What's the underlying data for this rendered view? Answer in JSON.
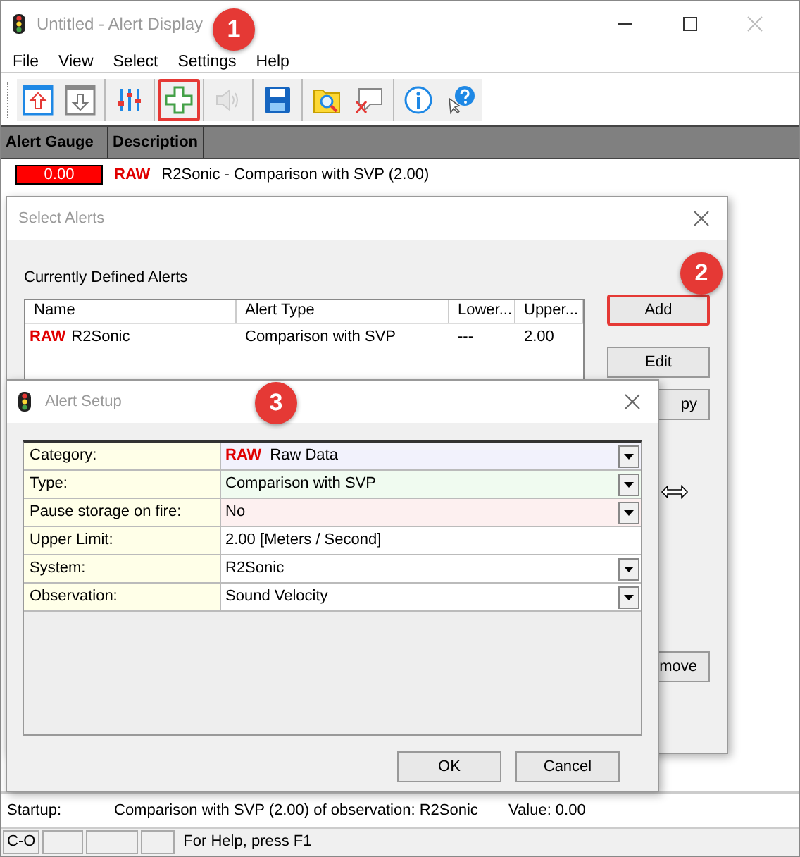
{
  "window": {
    "title": "Untitled - Alert Display"
  },
  "menu": [
    "File",
    "View",
    "Select",
    "Settings",
    "Help"
  ],
  "toolbar": [
    [
      {
        "kind": "upload",
        "highlighted": false,
        "disabled": false
      },
      {
        "kind": "download",
        "highlighted": false,
        "disabled": false
      }
    ],
    [
      {
        "kind": "sliders",
        "highlighted": false,
        "disabled": false
      }
    ],
    [
      {
        "kind": "add",
        "highlighted": true,
        "disabled": false
      }
    ],
    [
      {
        "kind": "sound",
        "highlighted": false,
        "disabled": true
      }
    ],
    [
      {
        "kind": "save",
        "highlighted": false,
        "disabled": false
      }
    ],
    [
      {
        "kind": "find",
        "highlighted": false,
        "disabled": false
      },
      {
        "kind": "clear",
        "highlighted": false,
        "disabled": false
      }
    ],
    [
      {
        "kind": "info",
        "highlighted": false,
        "disabled": false
      },
      {
        "kind": "help",
        "highlighted": false,
        "disabled": false
      }
    ]
  ],
  "alerts_table": {
    "columns": [
      "Alert Gauge",
      "Description"
    ],
    "rows": [
      {
        "gauge": "0.00",
        "category": "RAW",
        "description": "R2Sonic - Comparison with SVP (2.00)"
      }
    ]
  },
  "select_alerts": {
    "title": "Select Alerts",
    "section_label": "Currently Defined Alerts",
    "columns": [
      "Name",
      "Alert Type",
      "Lower...",
      "Upper..."
    ],
    "rows": [
      {
        "category": "RAW",
        "name": "R2Sonic",
        "type": "Comparison with SVP",
        "lower": "---",
        "upper": "2.00"
      }
    ],
    "buttons": [
      {
        "label": "Add",
        "highlighted": true
      },
      {
        "label": "Edit",
        "highlighted": false
      },
      {
        "label": "py",
        "highlighted": false
      },
      {
        "label": "move",
        "highlighted": false
      }
    ]
  },
  "alert_setup": {
    "title": "Alert Setup",
    "properties": [
      {
        "label": "Category:",
        "category": "RAW",
        "value": "Raw Data",
        "dropdown": true,
        "color": "#f2f2fc"
      },
      {
        "label": "Type:",
        "value": "Comparison with SVP",
        "dropdown": true,
        "color": "#f0fbf0"
      },
      {
        "label": "Pause storage on fire:",
        "value": "No",
        "dropdown": true,
        "color": "#fdf0f0"
      },
      {
        "label": "Upper Limit:",
        "value": "2.00 [Meters / Second]",
        "dropdown": false,
        "color": "#ffffff"
      },
      {
        "label": "System:",
        "value": "R2Sonic",
        "dropdown": true,
        "color": "#ffffff"
      },
      {
        "label": "Observation:",
        "value": "Sound Velocity",
        "dropdown": true,
        "color": "#ffffff"
      }
    ],
    "buttons": [
      "OK",
      "Cancel"
    ]
  },
  "log": {
    "label": "Startup:",
    "message": "Comparison with SVP (2.00) of observation: R2Sonic",
    "value": "Value: 0.00"
  },
  "status_bar": {
    "mode": "C-O",
    "help": "For Help, press F1"
  },
  "callouts": [
    "1",
    "2",
    "3"
  ]
}
